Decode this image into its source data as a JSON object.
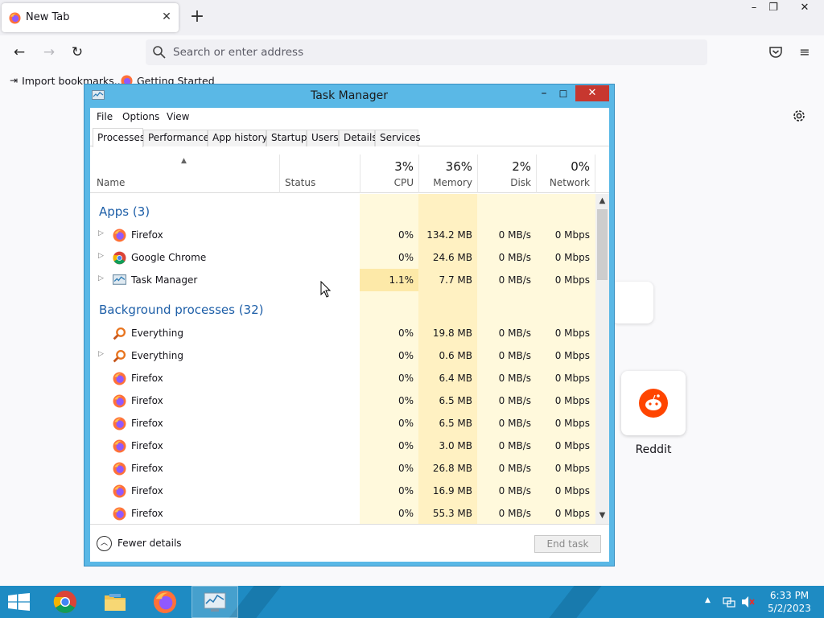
{
  "browser": {
    "tab_title": "New Tab",
    "url_placeholder": "Search or enter address",
    "bookmarks": [
      "Import bookmarks...",
      "Getting Started"
    ],
    "shortcut_label": "Reddit"
  },
  "task_manager": {
    "title": "Task Manager",
    "menu": [
      "File",
      "Options",
      "View"
    ],
    "tabs": [
      "Processes",
      "Performance",
      "App history",
      "Startup",
      "Users",
      "Details",
      "Services"
    ],
    "active_tab": "Processes",
    "columns": {
      "name": "Name",
      "status": "Status",
      "cpu": {
        "pct": "3%",
        "label": "CPU"
      },
      "memory": {
        "pct": "36%",
        "label": "Memory"
      },
      "disk": {
        "pct": "2%",
        "label": "Disk"
      },
      "network": {
        "pct": "0%",
        "label": "Network"
      }
    },
    "groups": [
      {
        "title": "Apps (3)"
      },
      {
        "title": "Background processes (32)"
      }
    ],
    "apps": [
      {
        "name": "Firefox",
        "icon": "firefox-icon",
        "cpu": "0%",
        "memory": "134.2 MB",
        "disk": "0 MB/s",
        "network": "0 Mbps"
      },
      {
        "name": "Google Chrome",
        "icon": "chrome-icon",
        "cpu": "0%",
        "memory": "24.6 MB",
        "disk": "0 MB/s",
        "network": "0 Mbps"
      },
      {
        "name": "Task Manager",
        "icon": "task-manager-icon",
        "cpu": "1.1%",
        "memory": "7.7 MB",
        "disk": "0 MB/s",
        "network": "0 Mbps"
      }
    ],
    "background": [
      {
        "name": "Everything",
        "icon": "everything-icon",
        "cpu": "0%",
        "memory": "19.8 MB",
        "disk": "0 MB/s",
        "network": "0 Mbps"
      },
      {
        "name": "Everything",
        "icon": "everything-icon",
        "cpu": "0%",
        "memory": "0.6 MB",
        "disk": "0 MB/s",
        "network": "0 Mbps"
      },
      {
        "name": "Firefox",
        "icon": "firefox-icon",
        "cpu": "0%",
        "memory": "6.4 MB",
        "disk": "0 MB/s",
        "network": "0 Mbps"
      },
      {
        "name": "Firefox",
        "icon": "firefox-icon",
        "cpu": "0%",
        "memory": "6.5 MB",
        "disk": "0 MB/s",
        "network": "0 Mbps"
      },
      {
        "name": "Firefox",
        "icon": "firefox-icon",
        "cpu": "0%",
        "memory": "6.5 MB",
        "disk": "0 MB/s",
        "network": "0 Mbps"
      },
      {
        "name": "Firefox",
        "icon": "firefox-icon",
        "cpu": "0%",
        "memory": "3.0 MB",
        "disk": "0 MB/s",
        "network": "0 Mbps"
      },
      {
        "name": "Firefox",
        "icon": "firefox-icon",
        "cpu": "0%",
        "memory": "26.8 MB",
        "disk": "0 MB/s",
        "network": "0 Mbps"
      },
      {
        "name": "Firefox",
        "icon": "firefox-icon",
        "cpu": "0%",
        "memory": "16.9 MB",
        "disk": "0 MB/s",
        "network": "0 Mbps"
      },
      {
        "name": "Firefox",
        "icon": "firefox-icon",
        "cpu": "0%",
        "memory": "55.3 MB",
        "disk": "0 MB/s",
        "network": "0 Mbps"
      }
    ],
    "footer": {
      "fewer_details": "Fewer details",
      "end_task": "End task"
    }
  },
  "taskbar": {
    "time": "6:33 PM",
    "date": "5/2/2023"
  },
  "colors": {
    "accent": "#1e8bc3",
    "tm_frame": "#5ab8e6",
    "group_title": "#1e5fa8",
    "heat_light": "#fff9dc",
    "heat_mid": "#fff1c2",
    "heat_high": "#fde9a8",
    "close_red": "#c7372f"
  }
}
